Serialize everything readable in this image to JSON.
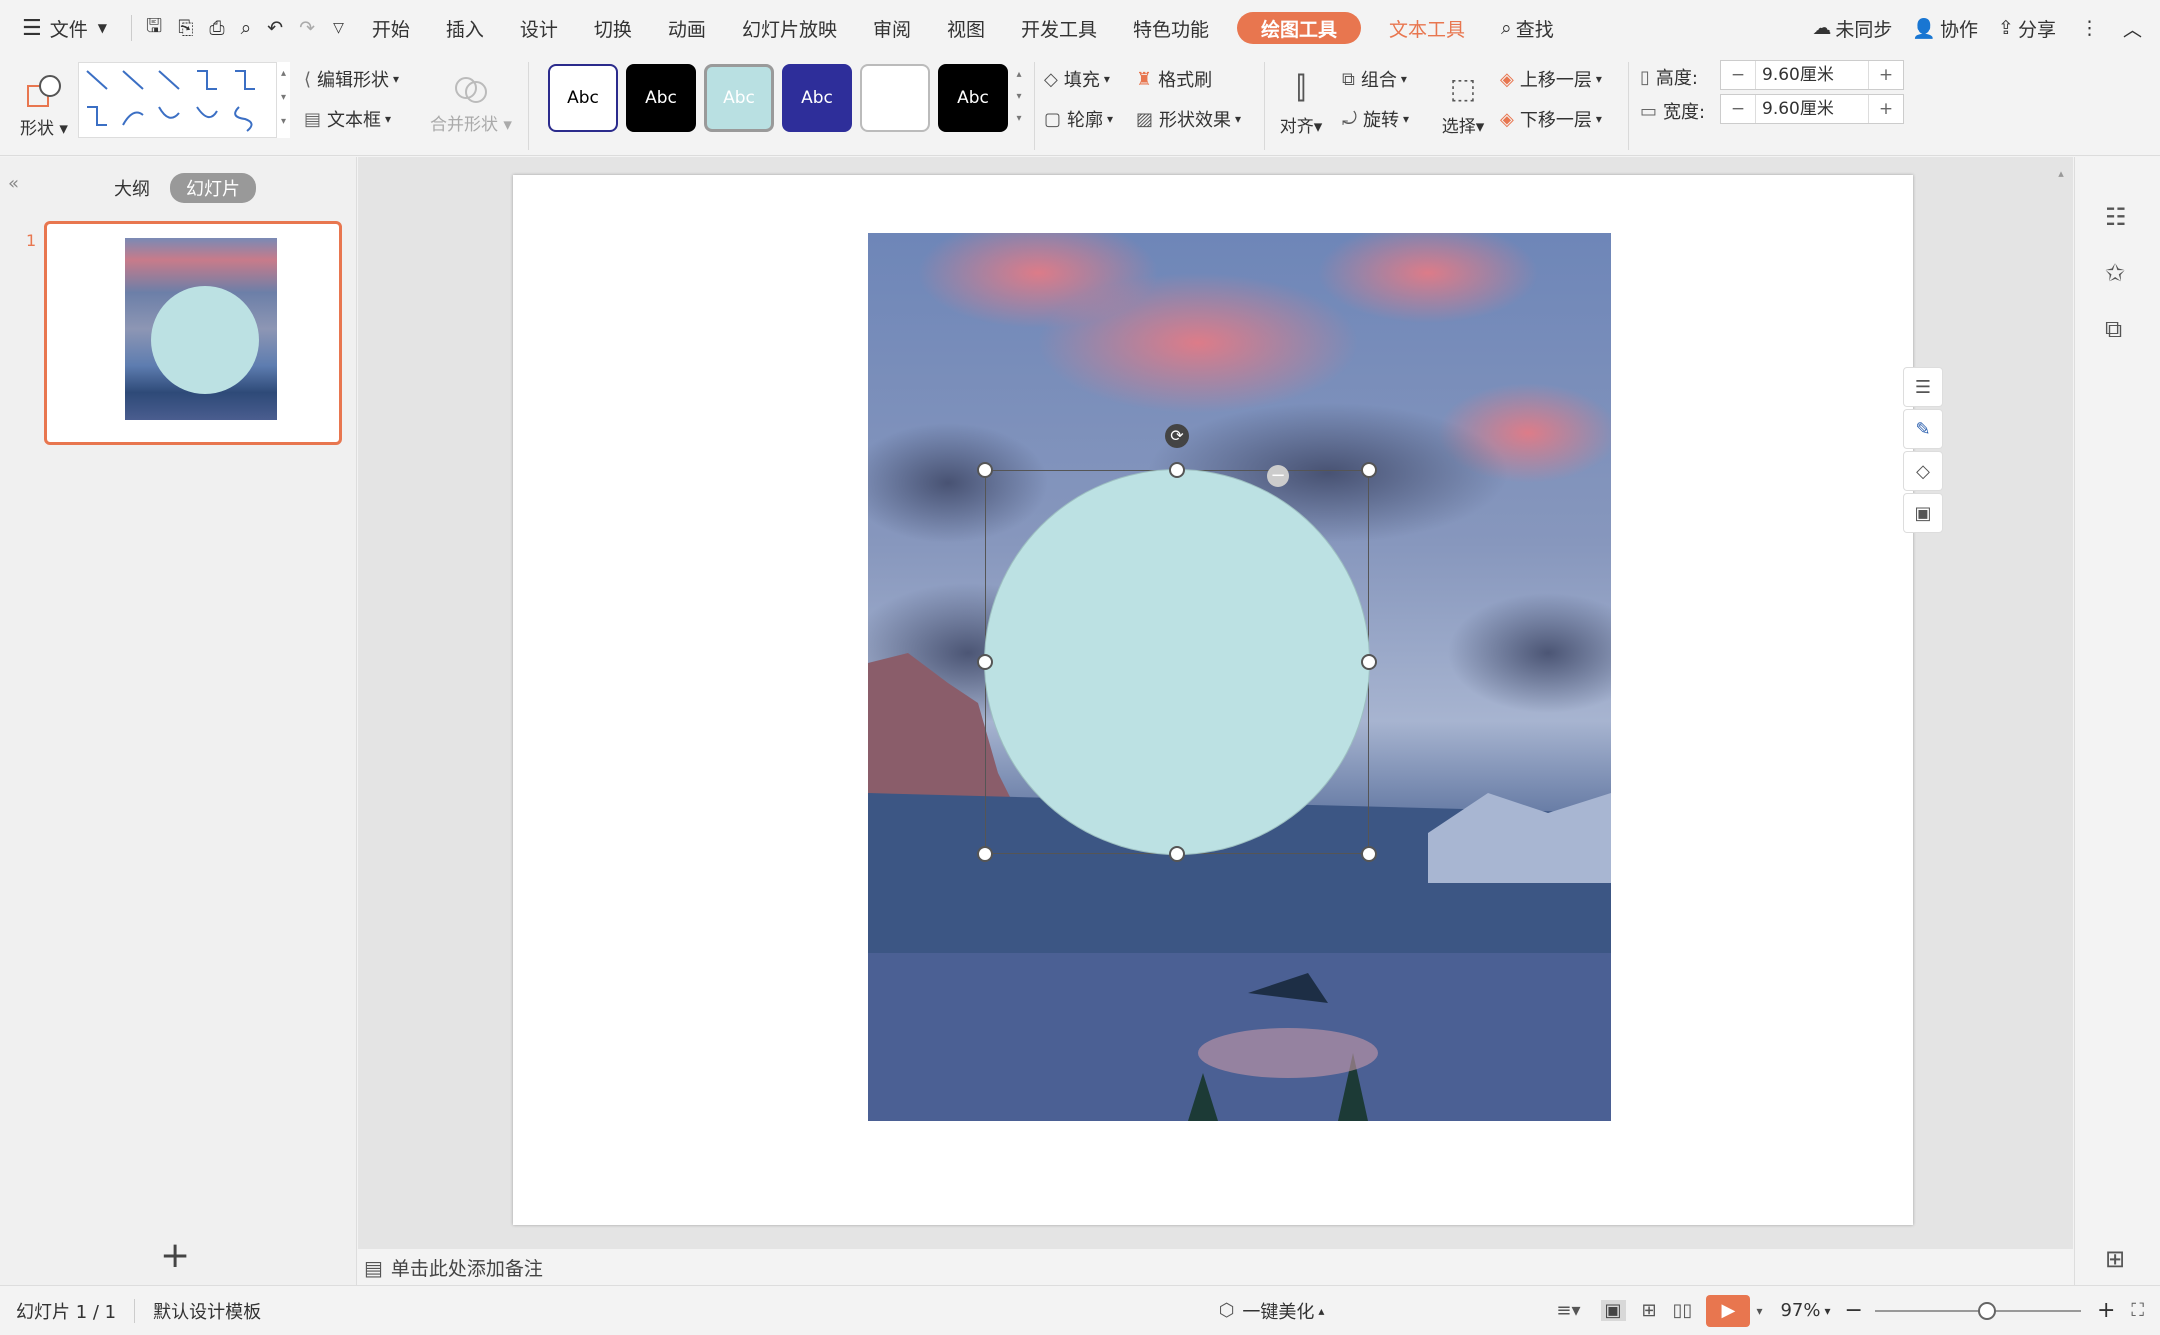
{
  "menubar": {
    "file_label": "文件",
    "tabs": [
      "开始",
      "插入",
      "设计",
      "切换",
      "动画",
      "幻灯片放映",
      "审阅",
      "视图",
      "开发工具",
      "特色功能"
    ],
    "drawing_tools": "绘图工具",
    "text_tools": "文本工具",
    "search": "查找",
    "sync": "未同步",
    "collab": "协作",
    "share": "分享"
  },
  "ribbon": {
    "shape_label": "形状",
    "edit_shape": "编辑形状",
    "textbox": "文本框",
    "merge_shape": "合并形状",
    "styles": [
      {
        "label": "Abc",
        "bg": "#ffffff",
        "fg": "#000000",
        "border": "#2b2b8c"
      },
      {
        "label": "Abc",
        "bg": "#000000",
        "fg": "#ffffff",
        "border": "#000000"
      },
      {
        "label": "Abc",
        "bg": "#b9e0e2",
        "fg": "#ffffff",
        "border": "#999999"
      },
      {
        "label": "Abc",
        "bg": "#2e2e9a",
        "fg": "#ffffff",
        "border": "#2e2e9a"
      },
      {
        "label": "",
        "bg": "#ffffff",
        "fg": "#000000",
        "border": "#bbbbbb"
      },
      {
        "label": "Abc",
        "bg": "#000000",
        "fg": "#ffffff",
        "border": "#000000"
      }
    ],
    "fill": "填充",
    "format_painter": "格式刷",
    "outline": "轮廓",
    "shape_effect": "形状效果",
    "align": "对齐",
    "group": "组合",
    "rotate": "旋转",
    "select": "选择",
    "bring_forward": "上移一层",
    "send_backward": "下移一层",
    "height_label": "高度:",
    "height_value": "9.60厘米",
    "width_label": "宽度:",
    "width_value": "9.60厘米"
  },
  "leftpanel": {
    "outline_tab": "大纲",
    "slides_tab": "幻灯片",
    "slide_number": "1"
  },
  "notes": {
    "placeholder": "单击此处添加备注"
  },
  "status": {
    "slide_info": "幻灯片 1 / 1",
    "template": "默认设计模板",
    "beautify": "一键美化",
    "zoom": "97%",
    "zoom_fraction": 0.55
  },
  "colors": {
    "accent": "#e8764f",
    "circle": "#bce1e3"
  }
}
